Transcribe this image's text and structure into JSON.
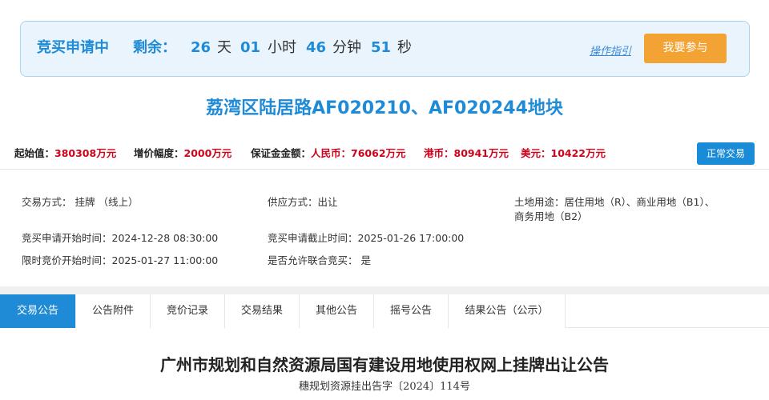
{
  "status": {
    "title": "竞买申请中",
    "remain_label": "剩余：",
    "days": "26",
    "days_unit": "天",
    "hours": "01",
    "hours_unit": "小时",
    "minutes": "46",
    "minutes_unit": "分钟",
    "seconds": "51",
    "seconds_unit": "秒",
    "guide_link": "操作指引",
    "join_button": "我要参与"
  },
  "land_title": "荔湾区陆居路AF020210、AF020244地块",
  "prices": {
    "start_label": "起始值：",
    "start_value": "380308万元",
    "increment_label": "增价幅度：",
    "increment_value": "2000万元",
    "deposit_label": "保证金金额：",
    "rmb_label": "人民币：",
    "rmb_value": "76062万元",
    "hkd_label": "港币：",
    "hkd_value": "80941万元",
    "usd_label": "美元：",
    "usd_value": "10422万元"
  },
  "trade_status_badge": "正常交易",
  "info": {
    "trade_method": "交易方式： 挂牌 （线上）",
    "supply_method": "供应方式：出让",
    "land_use_line1": "土地用途：居住用地（R）、商业用地（B1）、",
    "land_use_line2": "商务用地（B2）",
    "apply_start": "竞买申请开始时间：2024-12-28 08:30:00",
    "apply_end": "竞买申请截止时间：2025-01-26 17:00:00",
    "bid_start": "限时竞价开始时间：2025-01-27 11:00:00",
    "joint_bid": "是否允许联合竞买： 是"
  },
  "tabs": [
    "交易公告",
    "公告附件",
    "竞价记录",
    "交易结果",
    "其他公告",
    "摇号公告",
    "结果公告（公示）"
  ],
  "notice": {
    "title": "广州市规划和自然资源局国有建设用地使用权网上挂牌出让公告",
    "number": "穗规划资源挂出告字〔2024〕114号"
  },
  "colors": {
    "accent": "#1f8bd7",
    "button": "#f3a333",
    "price_red": "#d0021b"
  }
}
